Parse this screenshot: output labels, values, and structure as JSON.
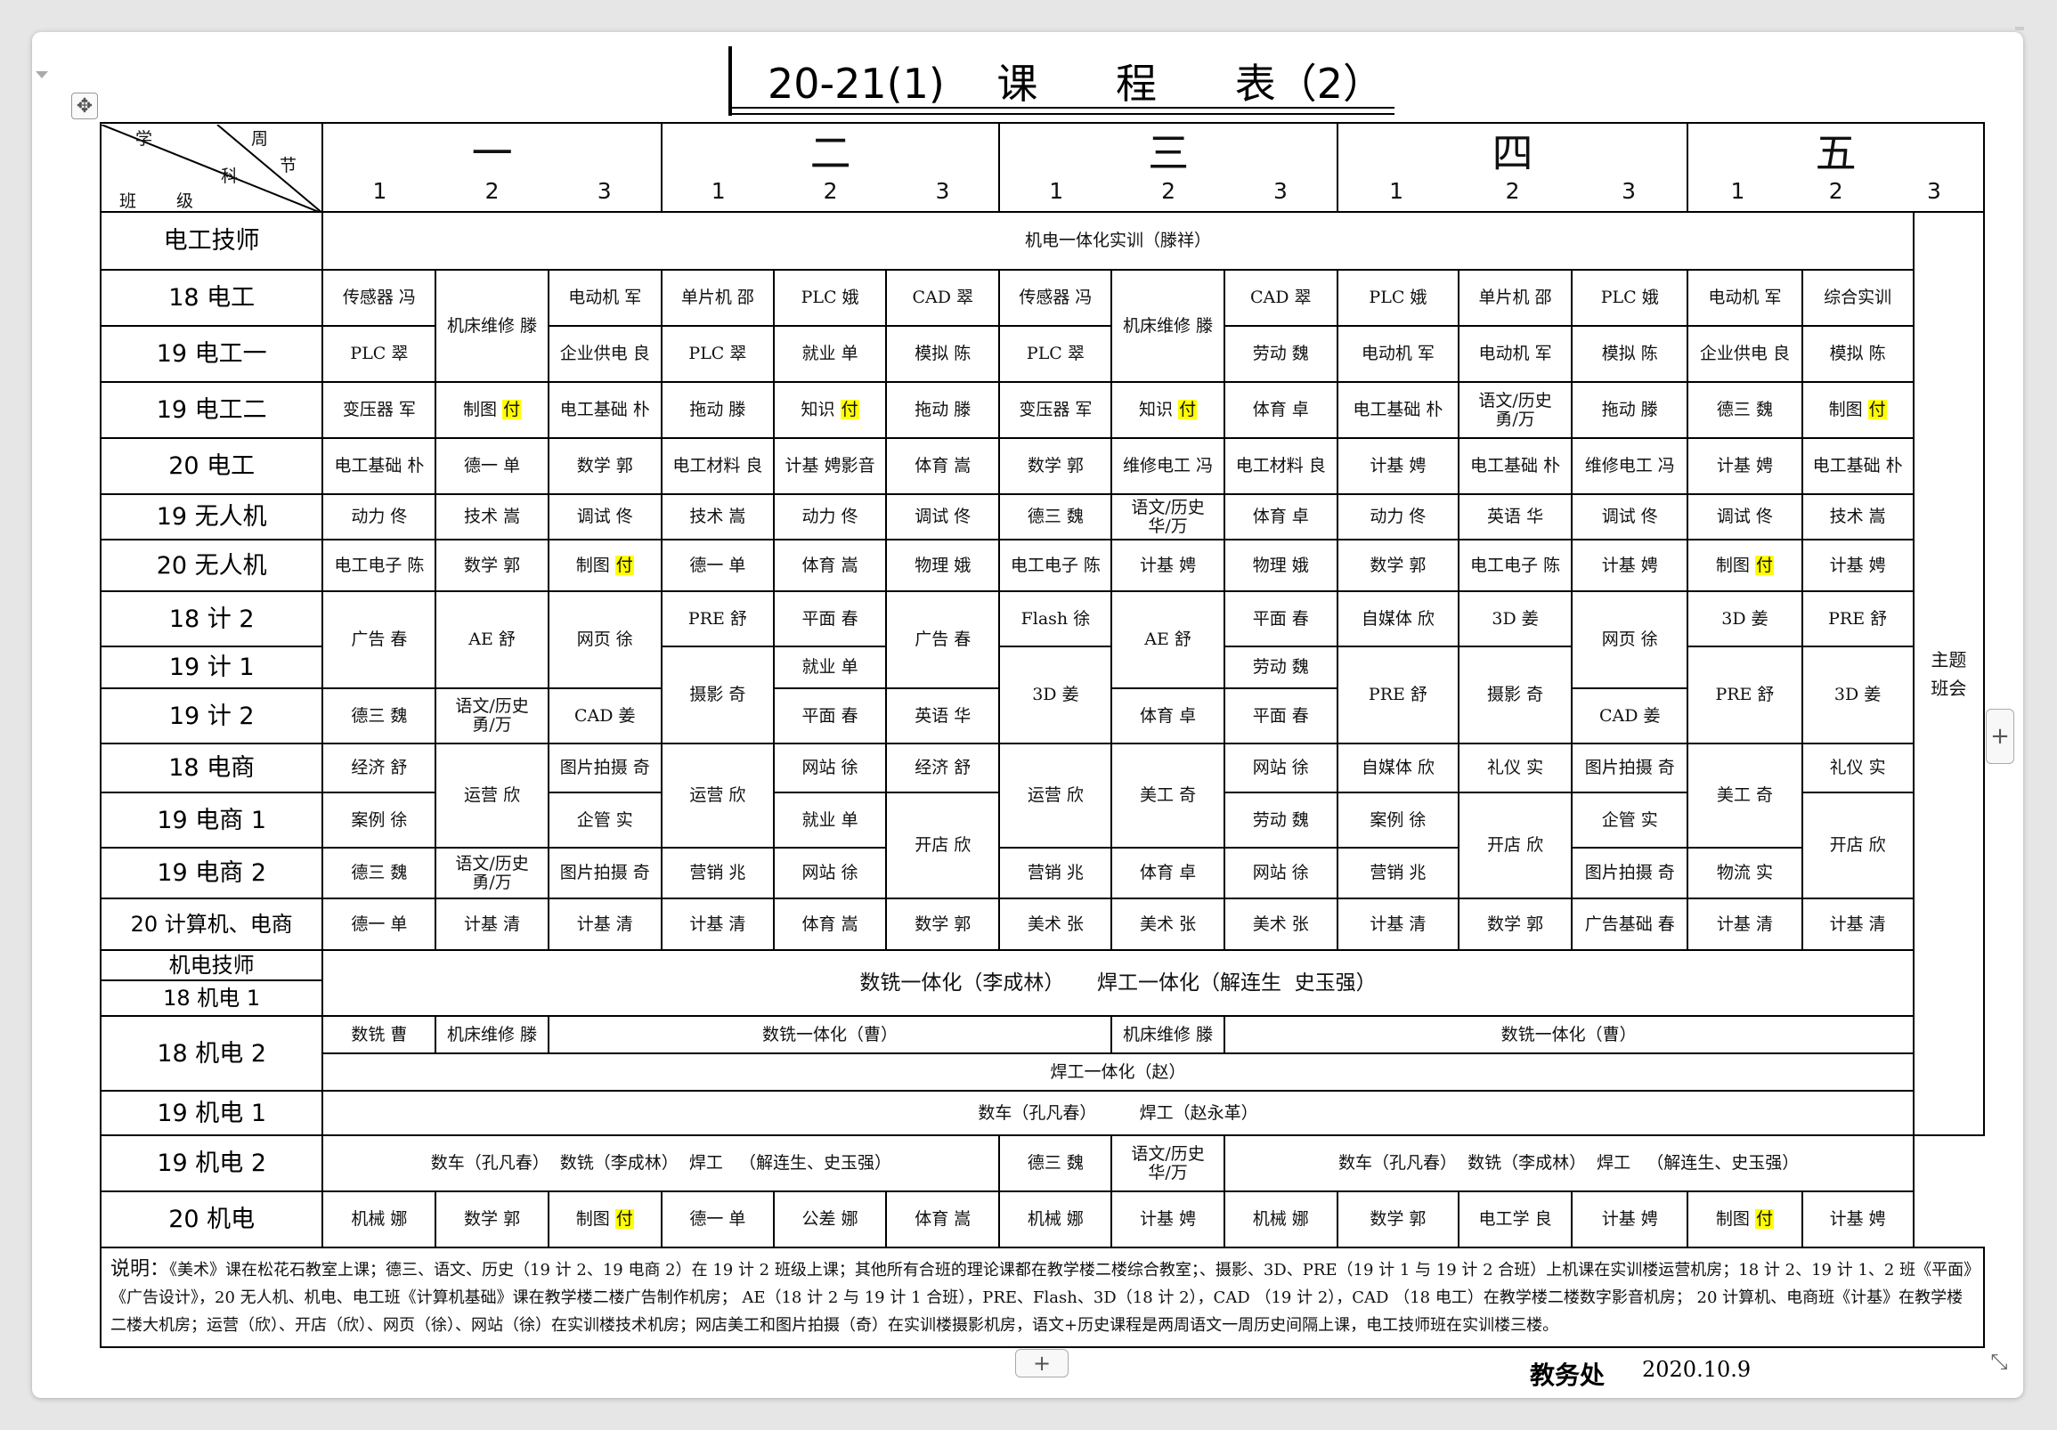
{
  "title": "20-21(1)    课      程      表（2）",
  "header": {
    "xueke": "学",
    "zhou": "周",
    "ke": "科",
    "jie": "节",
    "ban": "班",
    "ji": "级",
    "days": [
      "一",
      "二",
      "三",
      "四",
      "五"
    ],
    "periods": [
      [
        "1",
        "2",
        "3"
      ],
      [
        "1",
        "2",
        "3"
      ],
      [
        "1",
        "2",
        "3"
      ],
      [
        "1",
        "2",
        "3"
      ],
      [
        "1",
        "2",
        "3"
      ]
    ]
  },
  "rows": {
    "dgjs": {
      "label": "电工技师",
      "span": "机电一体化实训（滕祥）"
    },
    "e18": {
      "label": "18 电工",
      "c": [
        "传感器 冯",
        "机床维修 滕",
        "电动机 军",
        "单片机 邵",
        "PLC 娥",
        "CAD 翠",
        "传感器 冯",
        "机床维修 滕",
        "CAD 翠",
        "PLC 娥",
        "单片机 邵",
        "PLC 娥",
        "电动机 军",
        "综合实训"
      ]
    },
    "e191": {
      "label": "19 电工一",
      "c": [
        "PLC 翠",
        "企业供电 良",
        "PLC 翠",
        "就业 单",
        "模拟  陈",
        "PLC 翠",
        "劳动 魏",
        "电动机 军",
        "电动机 军",
        "模拟 陈",
        "企业供电 良",
        "模拟 陈"
      ]
    },
    "e192": {
      "label": "19 电工二",
      "c": [
        "变压器 军",
        "制图",
        "电工基础 朴",
        "拖动 滕",
        "知识",
        "拖动 滕",
        "变压器 军",
        "知识",
        "体育 卓",
        "电工基础 朴",
        "语文/历史勇/万",
        "拖动 滕",
        "德三 魏",
        "制图"
      ]
    },
    "e20": {
      "label": "20 电工",
      "c": [
        "电工基础 朴",
        "德一 单",
        "数学 郭",
        "电工材料 良",
        "计基 娉影音",
        "体育 嵩",
        "数学 郭",
        "维修电工 冯",
        "电工材料 良",
        "计基 娉",
        "电工基础 朴",
        "维修电工 冯",
        "计基 娉",
        "电工基础 朴"
      ]
    },
    "w19": {
      "label": "19 无人机",
      "c": [
        "动力 佟",
        "技术 嵩",
        "调试 佟",
        "技术 嵩",
        "动力 佟",
        "调试 佟",
        "德三 魏",
        "语文/历史华/万",
        "体育 卓",
        "动力 佟",
        "英语 华",
        "调试 佟",
        "调试 佟",
        "技术 嵩"
      ]
    },
    "w20": {
      "label": "20 无人机",
      "c": [
        "电工电子 陈",
        "数学 郭",
        "制图",
        "德一 单",
        "体育 嵩",
        "物理 娥",
        "电工电子 陈",
        "计基 娉",
        "物理 娥",
        "数学 郭",
        "电工电子 陈",
        "计基 娉",
        "制图",
        "计基 娉"
      ]
    },
    "j182": {
      "label": "18 计 2",
      "c": [
        "广告 春",
        "AE 舒",
        "网页 徐",
        "PRE 舒",
        "平面 春",
        "广告 春",
        "Flash  徐",
        "AE 舒",
        "平面 春",
        "自媒体 欣",
        "3D 姜",
        "网页 徐",
        "3D 姜",
        "PRE 舒"
      ]
    },
    "j191": {
      "label": "19 计 1",
      "c": [
        "就业 单",
        "摄影 奇",
        "3D 姜",
        "劳动 魏",
        "PRE 舒",
        "摄影 奇",
        "PRE 舒",
        "3D 姜"
      ]
    },
    "j192": {
      "label": "19 计 2",
      "c": [
        "德三 魏",
        "语文/历史勇/万",
        "CAD 姜",
        "平面 春",
        "英语 华",
        "体育 卓",
        "平面 春",
        "CAD 姜"
      ]
    },
    "s18": {
      "label": "18 电商",
      "c": [
        "经济 舒",
        "运营 欣",
        "图片拍摄 奇",
        "运营 欣",
        "网站 徐",
        "经济 舒",
        "运营 欣",
        "美工 奇",
        "网站 徐",
        "自媒体 欣",
        "礼仪 实",
        "图片拍摄 奇",
        "美工 奇",
        "礼仪 实"
      ]
    },
    "s191": {
      "label": "19 电商 1",
      "c": [
        "案例 徐",
        "企管 实",
        "就业 单",
        "开店 欣",
        "劳动 魏",
        "案例 徐",
        "开店 欣",
        "企管 实",
        "开店 欣"
      ]
    },
    "s192": {
      "label": "19 电商 2",
      "c": [
        "德三 魏",
        "语文/历史勇/万",
        "图片拍摄 奇",
        "营销 兆",
        "网站 徐",
        "营销 兆",
        "体育 卓",
        "网站 徐",
        "营销 兆",
        "图片拍摄 奇",
        "物流 实"
      ]
    },
    "js20": {
      "label": "20 计算机、电商",
      "c": [
        "德一 单",
        "计基 清",
        "计基 清",
        "计基 清",
        "体育 嵩",
        "数学 郭",
        "美术 张",
        "美术 张",
        "美术 张",
        "计基 清",
        "数学 郭",
        "广告基础 春",
        "计基 清",
        "计基 清"
      ]
    },
    "jdjs": {
      "label": "机电技师",
      "label2": "18 机电 1",
      "span": "数铣一体化（李成林）     焊工一体化（解连生  史玉强）"
    },
    "jd182": {
      "label": "18 机电 2",
      "c": [
        "数铣 曹",
        "机床维修 滕",
        "数铣一体化（曹）",
        "机床维修 滕",
        "数铣一体化（曹）"
      ],
      "span": "焊工一体化（赵）"
    },
    "jd191": {
      "label": "19 机电 1",
      "span": "数车（孔凡春）        焊工（赵永革）"
    },
    "jd192": {
      "label": "19 机电 2",
      "c": [
        "数车（孔凡春）  数铣（李成林）  焊工   （解连生、史玉强）",
        "德三 魏",
        "语文/历史华/万",
        "数车（孔凡春）  数铣（李成林）  焊工   （解连生、史玉强）"
      ]
    },
    "jd20": {
      "label": "20 机电",
      "c": [
        "机械 娜",
        "数学 郭",
        "制图",
        "德一 单",
        "公差 娜",
        "体育 嵩",
        "机械 娜",
        "计基 娉",
        "机械 娜",
        "数学 郭",
        "电工学 良",
        "计基 娉",
        "制图",
        "计基 娉"
      ]
    },
    "themeCell": "主题班会",
    "hl": "付"
  },
  "note": {
    "lead": "说明：",
    "text": "《美术》课在松花石教室上课；德三、语文、历史（19 计 2、19 电商 2）在 19 计 2 班级上课；其他所有合班的理论课都在教学楼二楼综合教室；、摄影、3D、PRE（19 计 1 与 19 计 2 合班）上机课在实训楼运营机房；18 计 2、19 计 1、2 班《平面》《广告设计》，20 无人机、机电、电工班《计算机基础》课在教学楼二楼广告制作机房；  AE（18 计 2 与 19 计 1 合班），PRE、Flash、3D（18 计 2），CAD （19 计 2），CAD （18 电工）在教学楼二楼数字影音机房；  20 计算机、电商班《计基》在教学楼二楼大机房；运营（欣）、开店（欣）、网页（徐）、网站（徐）在实训楼技术机房；网店美工和图片拍摄（奇）在实训楼摄影机房，语文+历史课程是两周语文一周历史间隔上课，电工技师班在实训楼三楼。"
  },
  "footer": {
    "dept": "教务处",
    "date": "2020.10.9"
  },
  "ui": {
    "move_icon": "✥",
    "plus": "+",
    "resize": "⤡"
  }
}
